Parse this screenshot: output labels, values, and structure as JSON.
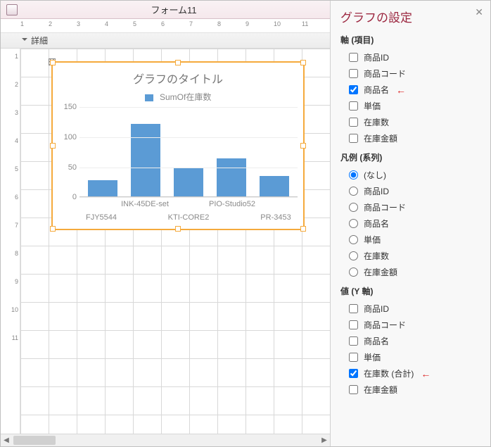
{
  "window": {
    "title": "フォーム11"
  },
  "section": {
    "detail_label": "詳細"
  },
  "chart_data": {
    "type": "bar",
    "title": "グラフのタイトル",
    "legend": "SumOf在庫数",
    "categories": [
      "FJY5544",
      "INK-45DE-set",
      "KTI-CORE2",
      "PIO-Studio52",
      "PR-3453"
    ],
    "values": [
      28,
      122,
      50,
      65,
      35
    ],
    "ylabel": "",
    "xlabel": "",
    "ylim": [
      0,
      150
    ],
    "yticks": [
      0,
      50,
      100,
      150
    ]
  },
  "panel": {
    "title": "グラフの設定",
    "groups": {
      "axis": {
        "title": "軸 (項目)",
        "items": [
          {
            "label": "商品ID",
            "checked": false,
            "highlight": false
          },
          {
            "label": "商品コード",
            "checked": false,
            "highlight": false
          },
          {
            "label": "商品名",
            "checked": true,
            "highlight": true
          },
          {
            "label": "単価",
            "checked": false,
            "highlight": false
          },
          {
            "label": "在庫数",
            "checked": false,
            "highlight": false
          },
          {
            "label": "在庫金額",
            "checked": false,
            "highlight": false
          }
        ]
      },
      "legend": {
        "title": "凡例 (系列)",
        "items": [
          {
            "label": "(なし)",
            "checked": true
          },
          {
            "label": "商品ID",
            "checked": false
          },
          {
            "label": "商品コード",
            "checked": false
          },
          {
            "label": "商品名",
            "checked": false
          },
          {
            "label": "単価",
            "checked": false
          },
          {
            "label": "在庫数",
            "checked": false
          },
          {
            "label": "在庫金額",
            "checked": false
          }
        ]
      },
      "value": {
        "title": "値 (Y 軸)",
        "items": [
          {
            "label": "商品ID",
            "checked": false,
            "highlight": false
          },
          {
            "label": "商品コード",
            "checked": false,
            "highlight": false
          },
          {
            "label": "商品名",
            "checked": false,
            "highlight": false
          },
          {
            "label": "単価",
            "checked": false,
            "highlight": false
          },
          {
            "label": "在庫数 (合計)",
            "checked": true,
            "highlight": true
          },
          {
            "label": "在庫金額",
            "checked": false,
            "highlight": false
          }
        ]
      }
    }
  },
  "ruler": {
    "h": [
      "1",
      "2",
      "3",
      "4",
      "5",
      "6",
      "7",
      "8",
      "9",
      "10",
      "11"
    ],
    "v": [
      "1",
      "2",
      "3",
      "4",
      "5",
      "6",
      "7",
      "8",
      "9",
      "10",
      "11"
    ]
  }
}
